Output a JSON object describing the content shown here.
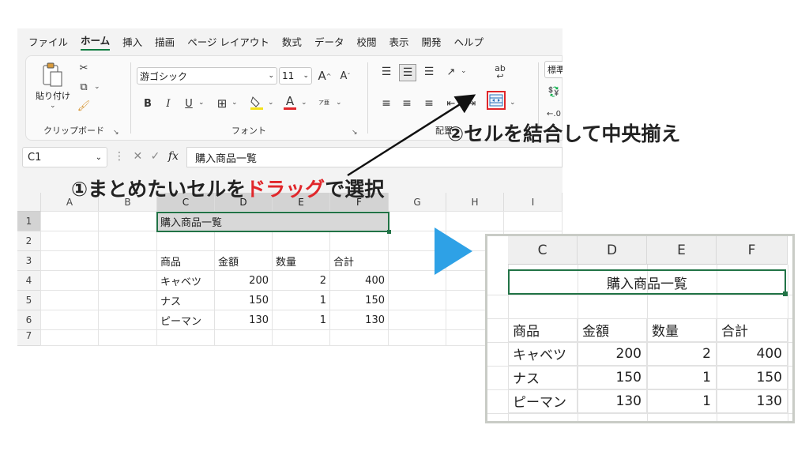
{
  "menu": [
    "ファイル",
    "ホーム",
    "挿入",
    "描画",
    "ページ レイアウト",
    "数式",
    "データ",
    "校閲",
    "表示",
    "開発",
    "ヘルプ"
  ],
  "ribbon": {
    "paste_label": "貼り付け",
    "clipboard_group": "クリップボード",
    "font_name": "游ゴシック",
    "font_size": "11",
    "font_group": "フォント",
    "alignment_group": "配置",
    "number_format": "標準",
    "bold": "B",
    "italic": "I",
    "underline": "U",
    "grow_font": "A",
    "shrink_font": "A",
    "font_color": "A",
    "furigana": "ア亜",
    "wrap_text": "ab"
  },
  "formula_bar": {
    "name_box": "C1",
    "fx": "fx",
    "formula": "購入商品一覧"
  },
  "sheet": {
    "columns": [
      "A",
      "B",
      "C",
      "D",
      "E",
      "F",
      "G",
      "H",
      "I"
    ],
    "rows": [
      "1",
      "2",
      "3",
      "4",
      "5",
      "6",
      "7"
    ],
    "title": "購入商品一覧",
    "headers": [
      "商品",
      "金額",
      "数量",
      "合計"
    ],
    "data": [
      [
        "キャベツ",
        "200",
        "2",
        "400"
      ],
      [
        "ナス",
        "150",
        "1",
        "150"
      ],
      [
        "ピーマン",
        "130",
        "1",
        "130"
      ]
    ]
  },
  "annotations": {
    "step1_prefix": "①まとめたいセルを",
    "step1_highlight": "ドラッグ",
    "step1_suffix": "で選択",
    "step2": "②セルを結合して中央揃え"
  },
  "zoom": {
    "columns": [
      "C",
      "D",
      "E",
      "F"
    ],
    "title": "購入商品一覧",
    "headers": [
      "商品",
      "金額",
      "数量",
      "合計"
    ],
    "data": [
      [
        "キャベツ",
        "200",
        "2",
        "400"
      ],
      [
        "ナス",
        "150",
        "1",
        "150"
      ],
      [
        "ピーマン",
        "130",
        "1",
        "130"
      ]
    ]
  },
  "colors": {
    "excel_green": "#217346",
    "highlight_red": "#e0262a",
    "play_blue": "#2ea1e6"
  }
}
